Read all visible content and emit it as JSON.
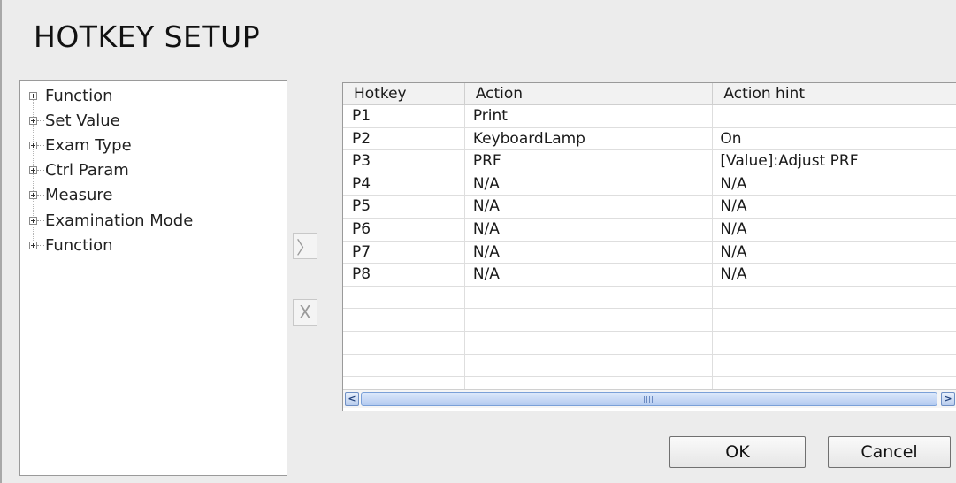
{
  "window": {
    "title": "HOTKEY SETUP"
  },
  "tree": {
    "items": [
      {
        "label": "Function"
      },
      {
        "label": "Set Value"
      },
      {
        "label": "Exam Type"
      },
      {
        "label": "Ctrl Param"
      },
      {
        "label": "Measure"
      },
      {
        "label": "Examination Mode"
      },
      {
        "label": "Function"
      }
    ]
  },
  "middle_buttons": {
    "assign_label": "〉",
    "remove_label": "X"
  },
  "table": {
    "columns": [
      "Hotkey",
      "Action",
      "Action hint"
    ],
    "rows": [
      [
        "P1",
        "Print",
        ""
      ],
      [
        "P2",
        "KeyboardLamp",
        "On"
      ],
      [
        "P3",
        "PRF",
        "[Value]:Adjust PRF"
      ],
      [
        "P4",
        "N/A",
        "N/A"
      ],
      [
        "P5",
        "N/A",
        "N/A"
      ],
      [
        "P6",
        "N/A",
        "N/A"
      ],
      [
        "P7",
        "N/A",
        "N/A"
      ],
      [
        "P8",
        "N/A",
        "N/A"
      ],
      [
        "",
        "",
        ""
      ],
      [
        "",
        "",
        ""
      ],
      [
        "",
        "",
        ""
      ],
      [
        "",
        "",
        ""
      ],
      [
        "",
        "",
        ""
      ]
    ],
    "scroll_left_icon": "<",
    "scroll_right_icon": ">"
  },
  "buttons": {
    "ok": "OK",
    "cancel": "Cancel"
  }
}
